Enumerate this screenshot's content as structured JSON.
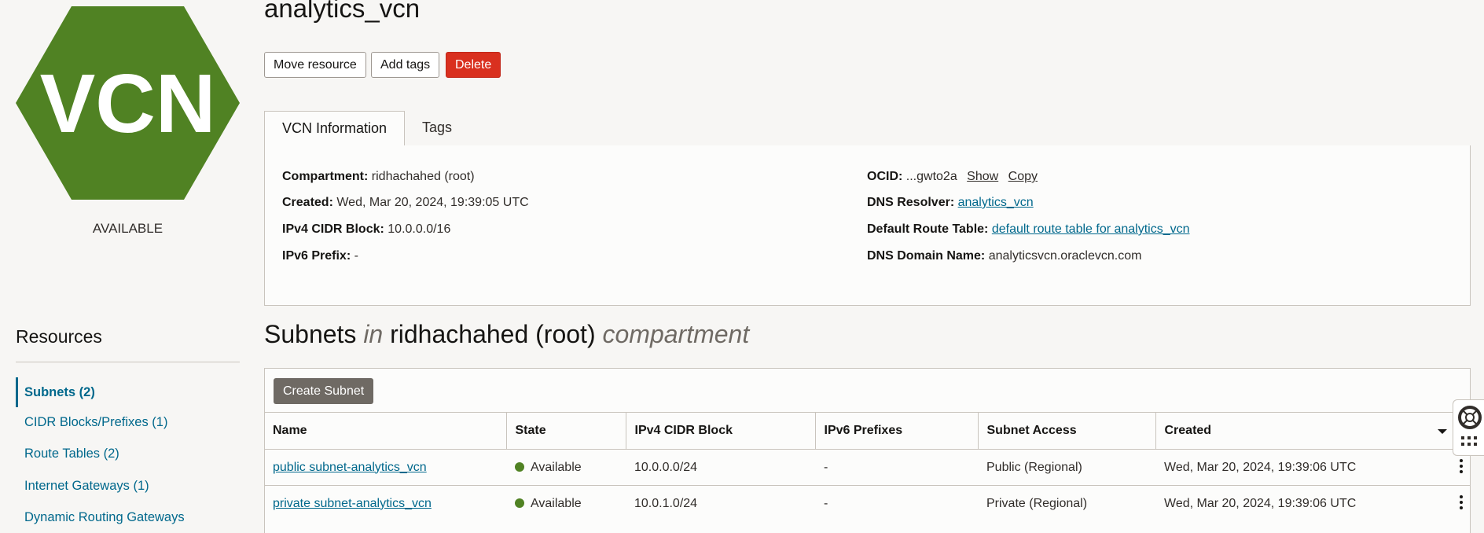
{
  "resource": {
    "icon_text": "VCN",
    "status": "AVAILABLE",
    "name": "analytics_vcn",
    "icon_color": "#508223"
  },
  "actions": {
    "move": "Move resource",
    "add_tags": "Add tags",
    "delete": "Delete"
  },
  "tabs": [
    "VCN Information",
    "Tags"
  ],
  "info": {
    "left": [
      {
        "label": "Compartment:",
        "value": "ridhachahed (root)"
      },
      {
        "label": "Created:",
        "value": "Wed, Mar 20, 2024, 19:39:05 UTC"
      },
      {
        "label": "IPv4 CIDR Block:",
        "value": "10.0.0.0/16"
      },
      {
        "label": "IPv6 Prefix:",
        "value": "-"
      }
    ],
    "ocid_label": "OCID:",
    "ocid_value": "...gwto2a",
    "ocid_show": "Show",
    "ocid_copy": "Copy",
    "dns_resolver_label": "DNS Resolver:",
    "dns_resolver_value": "analytics_vcn",
    "route_table_label": "Default Route Table:",
    "route_table_value": "default route table for analytics_vcn",
    "dns_domain_label": "DNS Domain Name:",
    "dns_domain_value": "analyticsvcn.oraclevcn.com"
  },
  "sidebar": {
    "title": "Resources",
    "items": [
      {
        "label": "Subnets (2)"
      },
      {
        "label": "CIDR Blocks/Prefixes (1)"
      },
      {
        "label": "Route Tables (2)"
      },
      {
        "label": "Internet Gateways (1)"
      },
      {
        "label": "Dynamic Routing Gateways"
      }
    ]
  },
  "subnets": {
    "title_part1": "Subnets",
    "title_in": "in",
    "title_part2": "ridhachahed (root)",
    "title_part3": "compartment",
    "create_label": "Create Subnet",
    "columns": [
      "Name",
      "State",
      "IPv4 CIDR Block",
      "IPv6 Prefixes",
      "Subnet Access",
      "Created"
    ],
    "rows": [
      {
        "name": "public subnet-analytics_vcn",
        "state": "Available",
        "cidr": "10.0.0.0/24",
        "ipv6": "-",
        "access": "Public (Regional)",
        "created": "Wed, Mar 20, 2024, 19:39:06 UTC"
      },
      {
        "name": "private subnet-analytics_vcn",
        "state": "Available",
        "cidr": "10.0.1.0/24",
        "ipv6": "-",
        "access": "Private (Regional)",
        "created": "Wed, Mar 20, 2024, 19:39:06 UTC"
      }
    ]
  }
}
